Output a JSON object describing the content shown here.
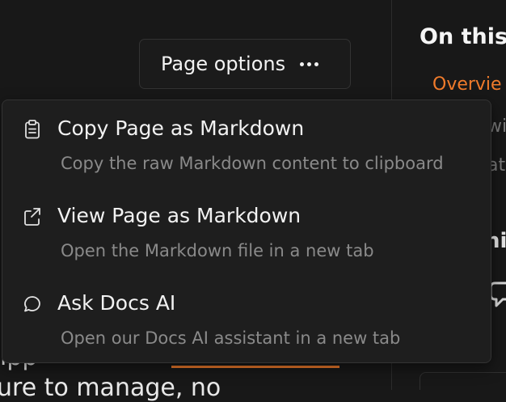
{
  "header": {
    "page_options_label": "Page options",
    "page_options_icon": "more-horizontal-icon"
  },
  "menu": {
    "items": [
      {
        "label": "Copy Page as Markdown",
        "description": "Copy the raw Markdown content to clipboard",
        "icon": "clipboard-icon"
      },
      {
        "label": "View Page as Markdown",
        "description": "Open the Markdown file in a new tab",
        "icon": "external-link-icon"
      },
      {
        "label": "Ask Docs AI",
        "description": "Open our Docs AI assistant in a new tab",
        "icon": "chat-bubble-icon"
      }
    ]
  },
  "toc": {
    "title": "On this",
    "active_link": "Overvie",
    "fragment_1": "wi",
    "fragment_2": "at",
    "fragment_3": "hi"
  },
  "background": {
    "line_1": "ıpp",
    "line_2": "ure to manage, no"
  },
  "colors": {
    "accent": "#f07b2b",
    "background": "#181818",
    "menu_background": "#1e1e1e",
    "text_primary": "#f2f2f2",
    "text_secondary": "#8a8a8a"
  }
}
